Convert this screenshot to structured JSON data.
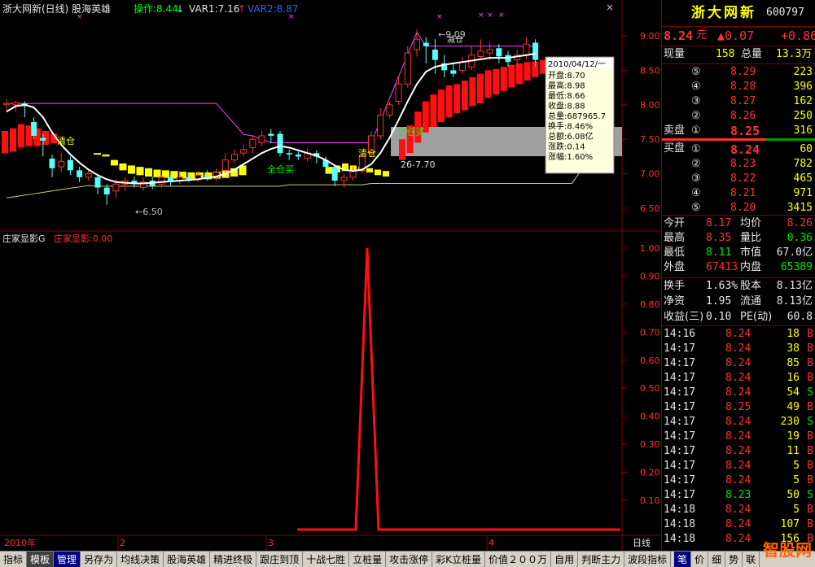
{
  "header": {
    "title": "浙大网新(日线) 股海英雄",
    "ind1_label": "操作:8.44",
    "ind1_arrow": "↓",
    "ind2_label": "VAR1:7.16",
    "ind2_arrow": "↑",
    "ind3_label": "VAR2:8.87"
  },
  "lower_header": {
    "name": "庄家显影G",
    "value_label": "庄家显影:0.00"
  },
  "upper_axis": [
    "9.00",
    "8.50",
    "8.00",
    "7.50",
    "7.00",
    "6.50"
  ],
  "lower_axis": [
    "1.00",
    "0.90",
    "0.80",
    "0.70",
    "0.60",
    "0.50",
    "0.40",
    "0.30",
    "0.20",
    "0.10"
  ],
  "time_axis": {
    "year": "2010年",
    "m2": "2",
    "m3": "3",
    "m4": "4",
    "tf": "日线"
  },
  "annotations": {
    "low": "←6.50",
    "high": "←9.09",
    "reduce": "减仓",
    "clear1": "清仓",
    "clear2": "清仓",
    "buyall": "全仓买",
    "buyall2": "全仓买",
    "point": "26-7.70"
  },
  "tooltip": {
    "date": "2010/04/12/一",
    "lines": [
      "开盘:8.70",
      "最高:8.98",
      "最低:8.66",
      "收盘:8.88",
      "总量:687965.7",
      "换手:8.46%",
      "总额:6.08亿",
      "涨跌:0.14",
      "涨幅:1.60%"
    ]
  },
  "quote": {
    "name": "浙大网新",
    "code": "600797",
    "price": "8.24",
    "unit": "元",
    "change": "▲0.07",
    "pct": "+0.86",
    "now_vol_label": "现量",
    "now_vol": "158",
    "total_vol_label": "总量",
    "total_vol": "13.3万",
    "sell_label": "卖盘",
    "buy_label": "买盘",
    "asks": [
      {
        "idx": "⑤",
        "price": "8.29",
        "vol": "223"
      },
      {
        "idx": "④",
        "price": "8.28",
        "vol": "396"
      },
      {
        "idx": "③",
        "price": "8.27",
        "vol": "162"
      },
      {
        "idx": "②",
        "price": "8.26",
        "vol": "250"
      },
      {
        "idx": "①",
        "price": "8.25",
        "vol": "316"
      }
    ],
    "bids": [
      {
        "idx": "①",
        "price": "8.24",
        "vol": "60"
      },
      {
        "idx": "②",
        "price": "8.23",
        "vol": "782"
      },
      {
        "idx": "③",
        "price": "8.22",
        "vol": "465"
      },
      {
        "idx": "④",
        "price": "8.21",
        "vol": "971"
      },
      {
        "idx": "⑤",
        "price": "8.20",
        "vol": "3415"
      }
    ],
    "stats": [
      {
        "l1": "今开",
        "v1": "8.17",
        "l2": "均价",
        "v2": "8.26"
      },
      {
        "l1": "最高",
        "v1": "8.35",
        "l2": "量比",
        "v2": "0.36"
      },
      {
        "l1": "最低",
        "v1": "8.11",
        "l2": "市值",
        "v2": "67.0亿"
      },
      {
        "l1": "外盘",
        "v1": "67413",
        "l2": "内盘",
        "v2": "65389"
      }
    ],
    "stats2": [
      {
        "l1": "换手",
        "v1": "1.63%",
        "l2": "股本",
        "v2": "8.13亿"
      },
      {
        "l1": "净资",
        "v1": "1.95",
        "l2": "流通",
        "v2": "8.13亿"
      },
      {
        "l1": "收益(三)",
        "v1": "0.10",
        "l2": "PE(动)",
        "v2": "60.8"
      }
    ],
    "ticks": [
      {
        "t": "14:16",
        "p": "8.24",
        "v": "18",
        "d": "B"
      },
      {
        "t": "14:17",
        "p": "8.24",
        "v": "38",
        "d": "B"
      },
      {
        "t": "14:17",
        "p": "8.24",
        "v": "85",
        "d": "B"
      },
      {
        "t": "14:17",
        "p": "8.24",
        "v": "16",
        "d": "B"
      },
      {
        "t": "14:17",
        "p": "8.24",
        "v": "54",
        "d": "S"
      },
      {
        "t": "14:17",
        "p": "8.25",
        "v": "49",
        "d": "B"
      },
      {
        "t": "14:17",
        "p": "8.24",
        "v": "230",
        "d": "S"
      },
      {
        "t": "14:17",
        "p": "8.24",
        "v": "19",
        "d": "B"
      },
      {
        "t": "14:17",
        "p": "8.24",
        "v": "11",
        "d": "B"
      },
      {
        "t": "14:17",
        "p": "8.24",
        "v": "5",
        "d": "B"
      },
      {
        "t": "14:17",
        "p": "8.24",
        "v": "5",
        "d": "B"
      },
      {
        "t": "14:17",
        "p": "8.23",
        "v": "50",
        "d": "S"
      },
      {
        "t": "14:18",
        "p": "8.24",
        "v": "5",
        "d": "B"
      },
      {
        "t": "14:18",
        "p": "8.24",
        "v": "107",
        "d": "B"
      },
      {
        "t": "14:18",
        "p": "8.24",
        "v": "156",
        "d": "B"
      }
    ]
  },
  "tabs": [
    "指标",
    "模板",
    "管理",
    "另存为",
    "均线决策",
    "股海英雄",
    "精进终极",
    "跟庄到顶",
    "十战七胜",
    "立桩量",
    "攻击涨停",
    "彩K立桩量",
    "价值２００万",
    "自用",
    "判断主力",
    "波段指标"
  ],
  "right_tabs": [
    "笔",
    "价",
    "细",
    "势",
    "联"
  ],
  "watermark": "智股网",
  "colors": {
    "up": "#ff3232",
    "down": "#54ffff",
    "axis": "#800000",
    "ma_white": "#ffffff",
    "band": "#ff40ff",
    "band_low": "#ffff80",
    "yellow_bars": "#ffff00",
    "gray_zone": "#a0a0a0"
  }
}
